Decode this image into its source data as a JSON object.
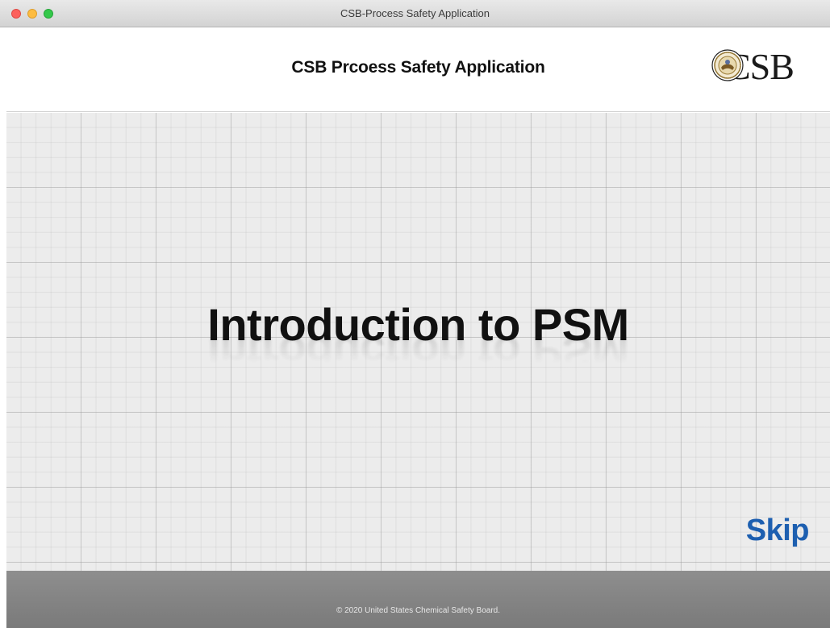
{
  "window": {
    "title": "CSB-Process Safety Application"
  },
  "header": {
    "title": "CSB Prcoess Safety Application",
    "logo_text": "CSB"
  },
  "main": {
    "title": "Introduction to PSM",
    "skip_label": "Skip"
  },
  "footer": {
    "text": "© 2020 United States Chemical Safety Board."
  },
  "colors": {
    "accent": "#1d5fb0",
    "footer_bg": "#7f7f7f",
    "grid_bg": "#ececec"
  },
  "icons": {
    "close": "close-window-icon",
    "minimize": "minimize-window-icon",
    "maximize": "maximize-window-icon",
    "seal": "csb-seal-icon"
  }
}
